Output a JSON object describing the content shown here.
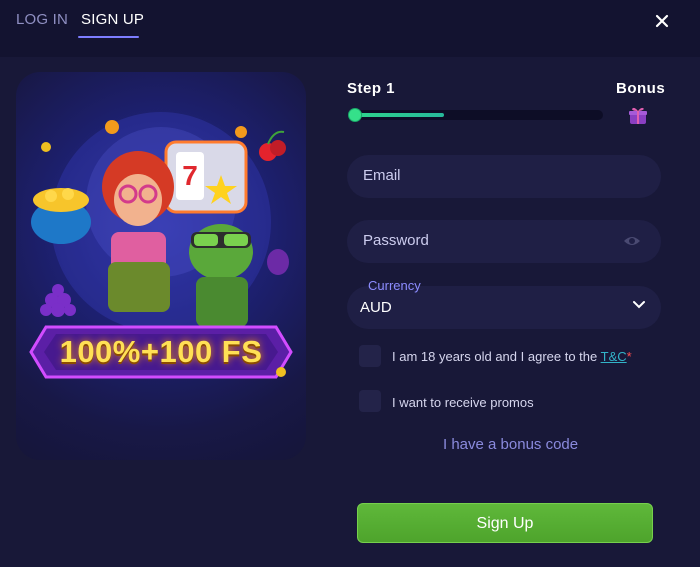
{
  "tabs": {
    "login": "LOG IN",
    "signup": "SIGN UP"
  },
  "promo": {
    "title": "100%+100 FS"
  },
  "step": {
    "label": "Step 1",
    "bonus_label": "Bonus",
    "progress": 0.37
  },
  "form": {
    "email_label": "Email",
    "password_label": "Password",
    "currency_caption": "Currency",
    "currency_value": "AUD",
    "age_text": "I am 18 years old and I agree to the ",
    "tc_link": "T&C",
    "asterisk": "*",
    "promo_text": "I want to receive promos",
    "bonus_code_link": "I have a bonus code",
    "submit_label": "Sign Up"
  },
  "colors": {
    "accent": "#7d7dff",
    "button": "#5cb336",
    "progress": "#2ed48a",
    "background": "#181838"
  }
}
